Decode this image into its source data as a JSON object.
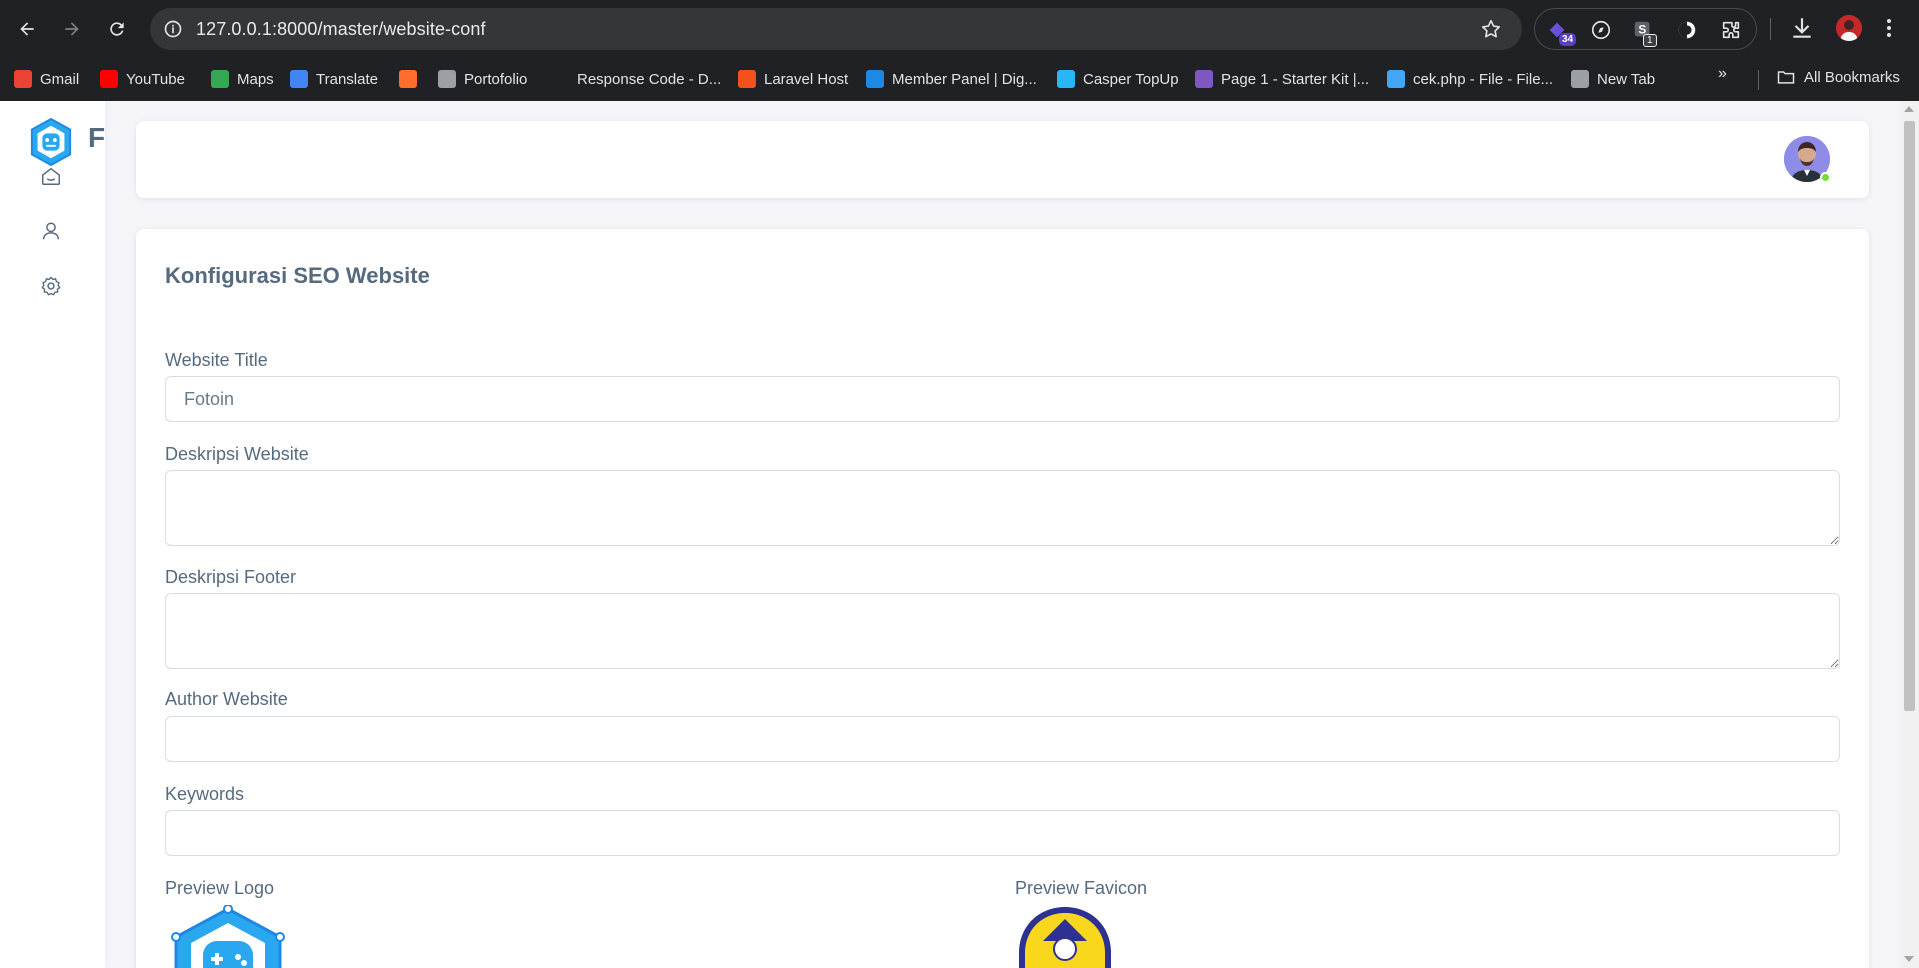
{
  "browser": {
    "url": "127.0.0.1:8000/master/website-conf",
    "extensions": {
      "badge_count": "34",
      "badge_small": "1"
    },
    "bookmarks": [
      {
        "label": "Gmail",
        "icon": "gmail-icon",
        "color": "#ea4335"
      },
      {
        "label": "YouTube",
        "icon": "youtube-icon",
        "color": "#ff0000"
      },
      {
        "label": "Maps",
        "icon": "maps-icon",
        "color": "#34a853"
      },
      {
        "label": "Translate",
        "icon": "translate-icon",
        "color": "#4285f4"
      },
      {
        "label": "",
        "icon": "cpanel-icon",
        "color": "#ff6c2c"
      },
      {
        "label": "Portofolio",
        "icon": "globe-icon",
        "color": "#9aa0a6"
      },
      {
        "label": "Response Code - D...",
        "icon": "bookmark-site-icon",
        "color": "#202124"
      },
      {
        "label": "Laravel Host",
        "icon": "laravel-icon",
        "color": "#f4511e"
      },
      {
        "label": "Member Panel | Dig...",
        "icon": "member-panel-icon",
        "color": "#1e88e5"
      },
      {
        "label": "Casper TopUp",
        "icon": "casper-icon",
        "color": "#29b6f6"
      },
      {
        "label": "Page 1 - Starter Kit |...",
        "icon": "starter-kit-icon",
        "color": "#7e57c2"
      },
      {
        "label": "cek.php - File - File...",
        "icon": "file-icon",
        "color": "#42a5f5"
      },
      {
        "label": "New Tab",
        "icon": "globe-icon",
        "color": "#9aa0a6"
      }
    ],
    "all_bookmarks": "All Bookmarks"
  },
  "sidebar": {
    "brand_letter": "F",
    "items": [
      {
        "name": "home",
        "icon": "home-icon"
      },
      {
        "name": "user",
        "icon": "user-icon"
      },
      {
        "name": "settings",
        "icon": "gear-icon"
      }
    ]
  },
  "main": {
    "title": "Konfigurasi SEO Website",
    "fields": {
      "website_title": {
        "label": "Website Title",
        "value": "Fotoin"
      },
      "description": {
        "label": "Deskripsi Website",
        "value": ""
      },
      "footer_description": {
        "label": "Deskripsi Footer",
        "value": ""
      },
      "author": {
        "label": "Author Website",
        "value": ""
      },
      "keywords": {
        "label": "Keywords",
        "value": ""
      }
    },
    "preview_logo_label": "Preview Logo",
    "preview_favicon_label": "Preview Favicon"
  },
  "colors": {
    "accent": "#03c3ec",
    "text": "#566a7f",
    "online": "#71dd37"
  }
}
